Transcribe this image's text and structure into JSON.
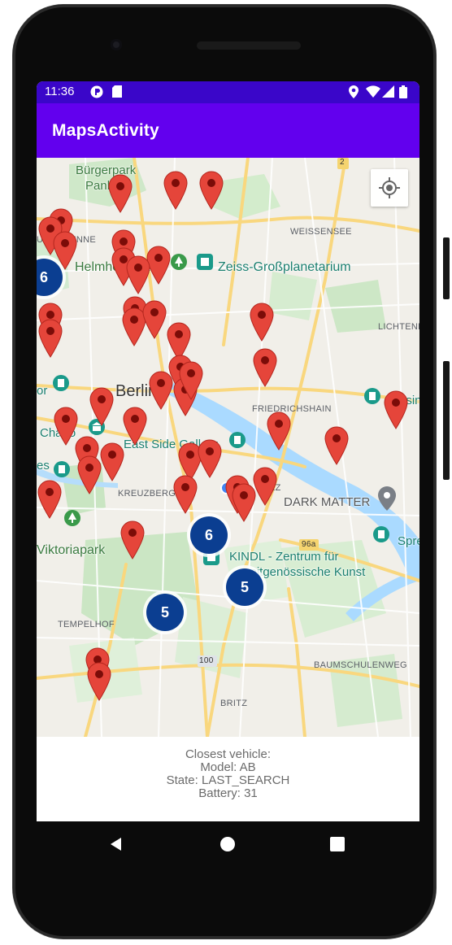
{
  "status_bar": {
    "time": "11:36",
    "icons": [
      "notification-app-icon",
      "sd-card-icon",
      "location-icon",
      "wifi-icon",
      "signal-icon",
      "battery-icon"
    ]
  },
  "app_bar": {
    "title": "MapsActivity"
  },
  "map": {
    "labels": {
      "buergerpark": "Bürgerpark",
      "pankow": "Pankow",
      "brunnen": "UNDBRUNNE",
      "weissensee": "WEISSENSEE",
      "helmholtz": "Helmholtzplatz",
      "zeiss": "Zeiss-Großplanetarium",
      "lichtenberg": "LICHTENBE",
      "berlin": "Berlin",
      "friedrichshain": "FRIEDRICHSHAIN",
      "east_side": "East Side Gallery",
      "charlottenburg": "Charlo",
      "kreuzberg": "KREUZBERG",
      "kiez": "KIEZ",
      "dark_matter": "DARK MATTER",
      "viktoriapark": "Viktoriapark",
      "kindl_line1": "KINDL - Zentrum für",
      "kindl_line2": "zeitgenössische Kunst",
      "tempelhof": "TEMPELHOF",
      "baumschulenweg": "BAUMSCHULENWEG",
      "britz": "BRITZ",
      "spree": "Spre",
      "kasino": "Kasin",
      "road_2": "2",
      "road_96a": "96a",
      "road_100": "100",
      "left_edge_or": "or",
      "left_edge_es": "es"
    },
    "clusters": [
      {
        "count": "6",
        "name": "cluster-west"
      },
      {
        "count": "6",
        "name": "cluster-center"
      },
      {
        "count": "5",
        "name": "cluster-south-east"
      },
      {
        "count": "5",
        "name": "cluster-south"
      }
    ],
    "marker_count": 41,
    "colors": {
      "marker": "#e5453a",
      "cluster": "#0b3e91",
      "app_bar": "#6200ee",
      "status_bar": "#3a06c9",
      "park": "#c8e6c9",
      "water": "#aadaff",
      "road": "#fde293"
    }
  },
  "info_panel": {
    "line1": "Closest vehicle:",
    "line2": "Model: AB",
    "line3": "State: LAST_SEARCH",
    "line4": "Battery: 31"
  }
}
